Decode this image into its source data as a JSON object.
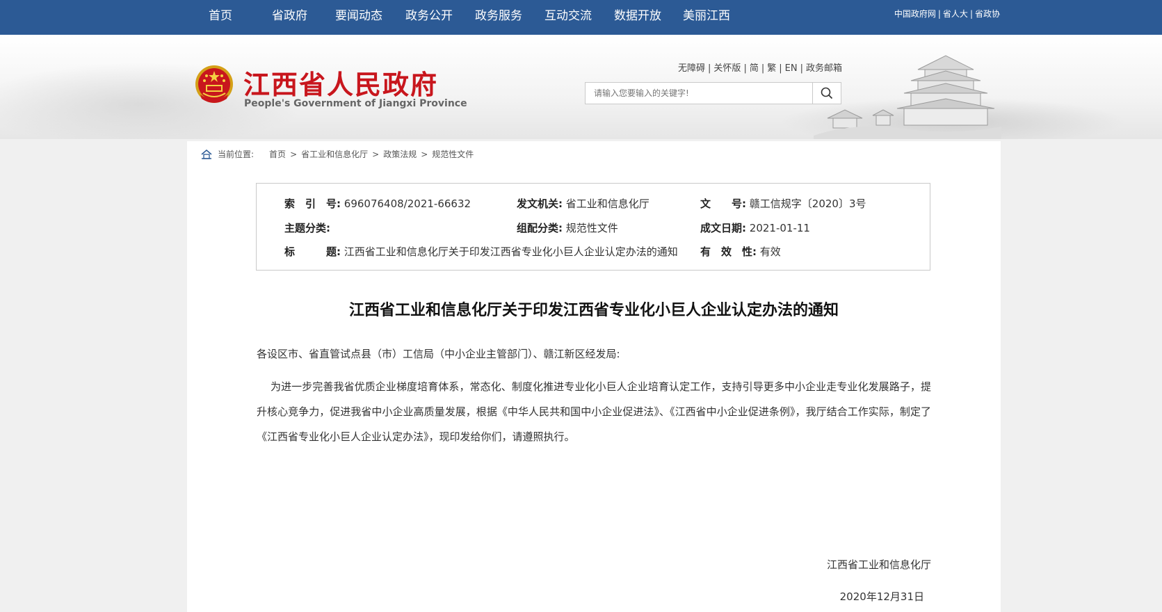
{
  "top_nav": {
    "items": [
      "首页",
      "省政府",
      "要闻动态",
      "政务公开",
      "政务服务",
      "互动交流",
      "数据开放",
      "美丽江西"
    ],
    "right_links": [
      "中国政府网",
      "省人大",
      "省政协"
    ]
  },
  "header": {
    "title": "江西省人民政府",
    "subtitle": "People's Government of Jiangxi Province",
    "utility_links": [
      "无障碍",
      "关怀版",
      "简",
      "繁",
      "EN",
      "政务邮箱"
    ],
    "search_placeholder": "请输入您要输入的关键字!"
  },
  "breadcrumb": {
    "label": "当前位置:",
    "items": [
      "首页",
      "省工业和信息化厅",
      "政策法规",
      "规范性文件"
    ]
  },
  "meta": {
    "index_label": "索　引　号:",
    "index_value": "696076408/2021-66632",
    "issuer_label": "发文机关:",
    "issuer_value": "省工业和信息化厅",
    "docno_label": "文　　号:",
    "docno_value": "赣工信规字〔2020〕3号",
    "topic_label": "主题分类:",
    "topic_value": "",
    "category_label": "组配分类:",
    "category_value": "规范性文件",
    "date_label": "成文日期:",
    "date_value": "2021-01-11",
    "title_label": "标　　　题:",
    "title_value": "江西省工业和信息化厅关于印发江西省专业化小巨人企业认定办法的通知",
    "validity_label": "有　效　性:",
    "validity_value": "有效"
  },
  "document": {
    "title": "江西省工业和信息化厅关于印发江西省专业化小巨人企业认定办法的通知",
    "salutation": "各设区市、省直管试点县（市）工信局（中小企业主管部门）、赣江新区经发局:",
    "body": "为进一步完善我省优质企业梯度培育体系，常态化、制度化推进专业化小巨人企业培育认定工作，支持引导更多中小企业走专业化发展路子，提升核心竞争力，促进我省中小企业高质量发展，根据《中华人民共和国中小企业促进法》、《江西省中小企业促进条例》，我厅结合工作实际，制定了《江西省专业化小巨人企业认定办法》，现印发给你们，请遵照执行。",
    "signature": "江西省工业和信息化厅",
    "date": "2020年12月31日"
  },
  "colors": {
    "nav_bg": "#2c5a95",
    "title_red": "#c8161d"
  }
}
